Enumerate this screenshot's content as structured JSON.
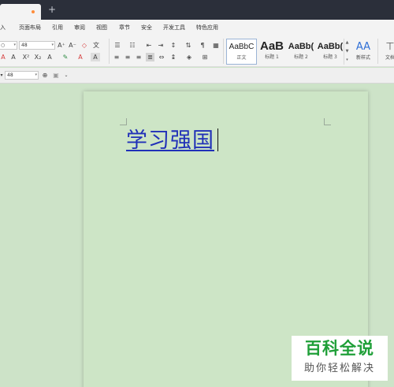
{
  "menu": {
    "items": [
      "入",
      "页面布局",
      "引用",
      "审阅",
      "视图",
      "章节",
      "安全",
      "开发工具",
      "特色应用"
    ]
  },
  "ribbon": {
    "font_name": "○",
    "font_size": "48",
    "format_glyphs": {
      "grow": "A⁺",
      "shrink": "A⁻",
      "clear": "◇",
      "pinyin": "文",
      "strike": "A",
      "super": "X²",
      "sub": "X₂",
      "effect": "A",
      "highlight": "✎",
      "font_color": "A",
      "char_shade": "A"
    },
    "styles": [
      {
        "sample": "AaBbC",
        "name": "正文"
      },
      {
        "sample": "AaB",
        "name": "标题 1"
      },
      {
        "sample": "AaBb(",
        "name": "标题 2"
      },
      {
        "sample": "AaBb(",
        "name": "标题 3"
      }
    ],
    "new_style_label": "新样式",
    "new_style_icon": "AA",
    "text_tool_label": "文档"
  },
  "smallbar": {
    "font_size": "48"
  },
  "document": {
    "text": "学习强国"
  },
  "watermark": {
    "title": "百科全说",
    "subtitle": "助你轻松解决"
  },
  "colors": {
    "tabbar": "#2b2f3a",
    "page_bg": "#cde5c6",
    "doc_text": "#2030b8",
    "watermark_green": "#1f9f38"
  }
}
